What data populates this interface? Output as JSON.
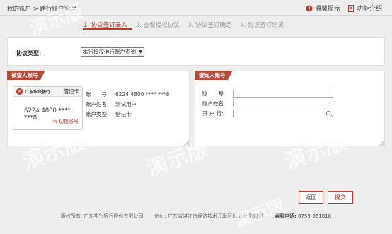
{
  "header": {
    "breadcrumb": "我的账户 > 跨行账户管理",
    "tips_label": "温馨提示",
    "features_label": "功能介绍"
  },
  "steps": [
    {
      "label": "1. 协议签订录入",
      "active": true
    },
    {
      "label": "2. 查看授权协议",
      "active": false
    },
    {
      "label": "3. 协议签订确定",
      "active": false
    },
    {
      "label": "4. 协议签订结果",
      "active": false
    }
  ],
  "agreement": {
    "type_label": "协议类型:",
    "type_value": "本行授权他行账户查询"
  },
  "queried": {
    "tag": "被查人账号",
    "bank_name": "广东华兴银行",
    "card_type": "借记卡",
    "card_number": "6224 4800 **** ***8",
    "switch_label": "切换账号",
    "fields": [
      {
        "key": "账　　号:",
        "value": "6224 4800 **** ***8"
      },
      {
        "key": "账户姓名:",
        "value": "测试用户"
      },
      {
        "key": "账户类型:",
        "value": "借记卡"
      }
    ]
  },
  "querier": {
    "tag": "查询人账号",
    "fields": [
      {
        "label": "账　　号:",
        "value": ""
      },
      {
        "label": "账户姓名:",
        "value": ""
      },
      {
        "label": "开 户 行:",
        "value": ""
      }
    ]
  },
  "buttons": {
    "back": "返回",
    "submit": "提交"
  },
  "footer": {
    "copyright": "版权所有: 广东华兴银行股份有限公司",
    "address": "地址: 广东省湛江市经济技术开发区乐山大道60号",
    "phone_label": "客服电话:",
    "phone": "0759-961818"
  },
  "watermark": "演示版",
  "colors": {
    "accent": "#c0392b",
    "tag_bg": "#b84a3a",
    "page_bg": "#eeeeee"
  }
}
